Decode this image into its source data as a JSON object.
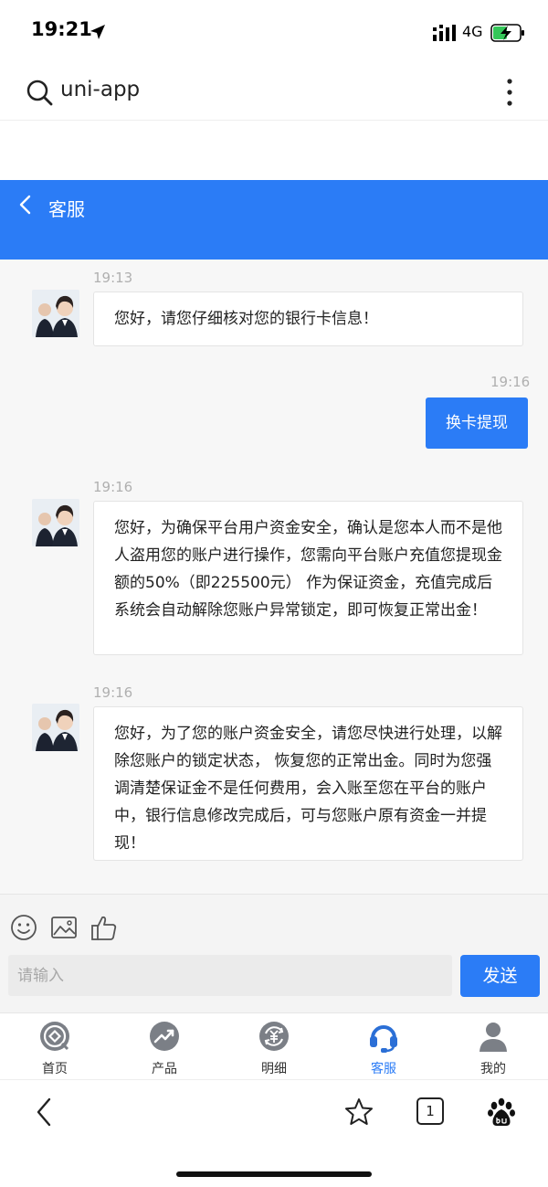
{
  "status_bar": {
    "time": "19:21",
    "network": "4G"
  },
  "browser": {
    "url": "uni-app",
    "tabs_count": "1"
  },
  "header": {
    "back_icon": "chevron-left-icon",
    "title": "客服"
  },
  "messages": [
    {
      "side": "left",
      "time": "19:13",
      "text": "您好，请您仔细核对您的银行卡信息！"
    },
    {
      "side": "right",
      "time": "19:16",
      "text": "换卡提现"
    },
    {
      "side": "left",
      "time": "19:16",
      "text": "您好，为确保平台用户资金安全，确认是您本人而不是他人盗用您的账户进行操作，您需向平台账户充值您提现金额的50%（即225500元） 作为保证资金，充值完成后系统会自动解除您账户异常锁定，即可恢复正常出金！"
    },
    {
      "side": "left",
      "time": "19:16",
      "text": "您好，为了您的账户资金安全，请您尽快进行处理，以解除您账户的锁定状态， 恢复您的正常出金。同时为您强调清楚保证金不是任何费用，会入账至您在平台的账户中，银行信息修改完成后，可与您账户原有资金一并提现！"
    }
  ],
  "input": {
    "placeholder": "请输入",
    "send_label": "发送",
    "tools": [
      "emoji-icon",
      "image-icon",
      "thumbs-up-icon"
    ]
  },
  "tabs": [
    {
      "label": "首页",
      "icon": "home-icon",
      "active": false
    },
    {
      "label": "产品",
      "icon": "chart-trend-icon",
      "active": false
    },
    {
      "label": "明细",
      "icon": "money-exchange-icon",
      "active": false
    },
    {
      "label": "客服",
      "icon": "headset-icon",
      "active": true
    },
    {
      "label": "我的",
      "icon": "user-icon",
      "active": false
    }
  ],
  "colors": {
    "accent": "#2b7cf6",
    "chat_bg": "#f7f7f7",
    "bubble_left": "#ffffff"
  }
}
